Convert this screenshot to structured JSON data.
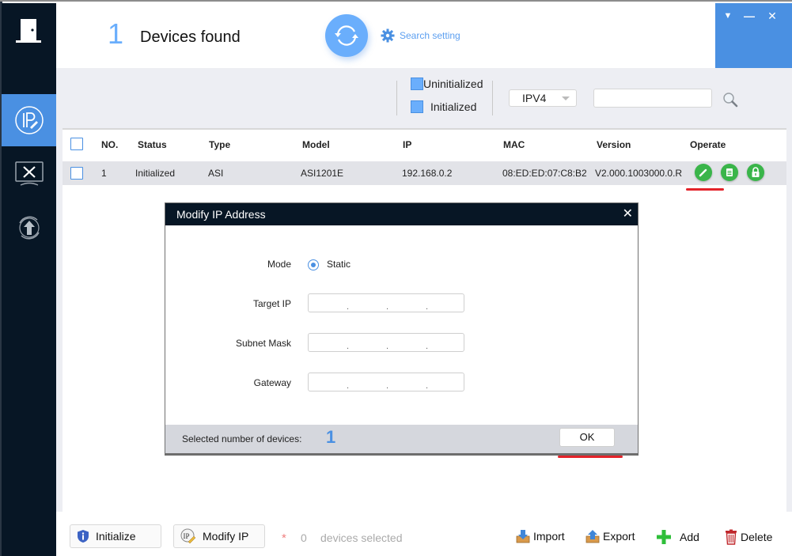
{
  "header": {
    "device_count": "1",
    "devices_found_label": "Devices found",
    "search_setting_label": "Search setting"
  },
  "window_controls": {
    "menu": "▼",
    "minimize": "—",
    "close": "✕"
  },
  "sidebar": {
    "items": [
      {
        "name": "ip-modify",
        "icon": "ip-pencil-icon",
        "active": true
      },
      {
        "name": "device-config",
        "icon": "tools-monitor-icon",
        "active": false
      },
      {
        "name": "upgrade",
        "icon": "upload-cycle-icon",
        "active": false
      }
    ]
  },
  "filters": {
    "uninitialized_label": "Uninitialized",
    "initialized_label": "Initialized",
    "ip_version": "IPV4",
    "search_value": ""
  },
  "table": {
    "columns": [
      "NO.",
      "Status",
      "Type",
      "Model",
      "IP",
      "MAC",
      "Version",
      "Operate"
    ],
    "rows": [
      {
        "no": "1",
        "status": "Initialized",
        "type": "ASI",
        "model": "ASI1201E",
        "ip": "192.168.0.2",
        "mac": "08:ED:ED:07:C8:B2",
        "version": "V2.000.1003000.0.R",
        "operations": [
          "edit-icon",
          "details-icon",
          "lock-icon"
        ]
      }
    ]
  },
  "dialog": {
    "title": "Modify IP Address",
    "close": "✕",
    "mode_label": "Mode",
    "mode_value": "Static",
    "target_ip_label": "Target IP",
    "subnet_mask_label": "Subnet Mask",
    "gateway_label": "Gateway",
    "ip_separator": ".",
    "target_ip": [
      "",
      "",
      "",
      ""
    ],
    "subnet_mask": [
      "",
      "",
      "",
      ""
    ],
    "gateway": [
      "",
      "",
      "",
      ""
    ],
    "selected_label": "Selected number of devices:",
    "selected_count": "1",
    "ok_label": "OK"
  },
  "bottom": {
    "initialize_label": "Initialize",
    "modify_ip_label": "Modify IP",
    "asterisk": "*",
    "selected_count": "0",
    "selected_label": "devices selected",
    "import_label": "Import",
    "export_label": "Export",
    "add_label": "Add",
    "delete_label": "Delete"
  },
  "colors": {
    "accent": "#4a90e2",
    "accent_light": "#6aaefc",
    "sidebar_bg": "#071625",
    "op_green": "#3ab54a",
    "highlight_red": "#e3232a"
  }
}
